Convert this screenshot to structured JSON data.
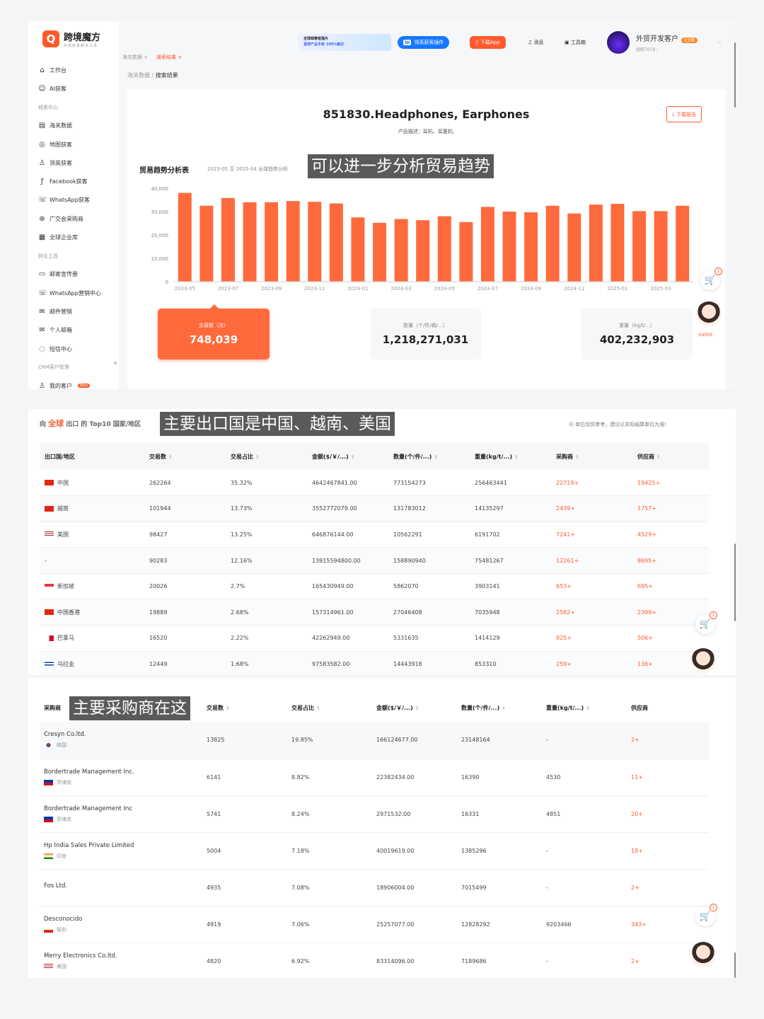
{
  "app": {
    "logo_char": "Q",
    "title": "跨境魔方",
    "subtitle": "外贸获客服务工具"
  },
  "sidebar": {
    "items": [
      {
        "label": "工作台",
        "icon": "home-icon",
        "glyph": "⌂"
      },
      {
        "label": "AI获客",
        "icon": "robot-icon",
        "glyph": "☺"
      },
      {
        "section": "线索中心"
      },
      {
        "label": "海关数据",
        "icon": "customs-icon",
        "glyph": "▤"
      },
      {
        "label": "地图获客",
        "icon": "map-icon",
        "glyph": "◎"
      },
      {
        "label": "领英获客",
        "icon": "person-icon",
        "glyph": "♙"
      },
      {
        "label": "Facebook获客",
        "icon": "facebook-icon",
        "glyph": "ƒ"
      },
      {
        "label": "WhatsApp获客",
        "icon": "whatsapp-icon",
        "glyph": "☏"
      },
      {
        "label": "广交会采购商",
        "icon": "globe-icon",
        "glyph": "⊕"
      },
      {
        "label": "全球企业库",
        "icon": "building-icon",
        "glyph": "▦"
      },
      {
        "section": "转化工具"
      },
      {
        "label": "邮寄宣传册",
        "icon": "brochure-icon",
        "glyph": "▭"
      },
      {
        "label": "WhatsApp营销中心",
        "icon": "whatsapp-icon",
        "glyph": "☏"
      },
      {
        "label": "邮件营销",
        "icon": "mail-icon",
        "glyph": "✉"
      },
      {
        "label": "个人邮箱",
        "icon": "mailbox-icon",
        "glyph": "✉"
      },
      {
        "label": "短信中心",
        "icon": "sms-icon",
        "glyph": "◌"
      },
      {
        "section": "CRM客户管理"
      },
      {
        "label": "我的客户",
        "icon": "customer-icon",
        "glyph": "♙",
        "badge": "New"
      }
    ],
    "collapse": "«"
  },
  "header": {
    "tabs": [
      "海关数据 ×",
      "搜索结果 ×"
    ],
    "promo_line1": "全球邮寄纸值片",
    "promo_line2": "直邮产品手册 100%触达",
    "linkedin_plugin": "领英获客插件",
    "download_app": "下载App",
    "messages": "消息",
    "toolbox": "工具箱",
    "user_name": "外贸开发客户",
    "user_badge": "企业版",
    "user_org": "组织7078 ›"
  },
  "breadcrumb": {
    "parent": "海关数据 / ",
    "current": "搜索结果"
  },
  "product": {
    "title": "851830.Headphones, Earphones",
    "description": "产品描述：耳机、耳塞机;",
    "download_report": "下载报告"
  },
  "trend": {
    "title": "贸易趋势分析表",
    "subtitle": "2023-05 至 2025-04 全球趋势分析"
  },
  "overlays": {
    "o1": "可以进一步分析贸易趋势",
    "o2": "主要出口国是中国、越南、美国",
    "o3": "主要采购商在这"
  },
  "stats": [
    {
      "label": "交易数（次）",
      "value": "748,039"
    },
    {
      "label": "数量（个/件/箱/...）",
      "value": "1,218,271,031"
    },
    {
      "label": "重量（kg/t/...）",
      "value": "402,232,903"
    }
  ],
  "floating": {
    "cart_count": "1",
    "agent_label": "外贸导师"
  },
  "chart_data": {
    "type": "bar",
    "x": [
      "2023-05",
      "2023-06",
      "2023-07",
      "2023-08",
      "2023-09",
      "2023-10",
      "2023-11",
      "2023-12",
      "2024-01",
      "2024-02",
      "2024-03",
      "2024-04",
      "2024-05",
      "2024-06",
      "2024-07",
      "2024-08",
      "2024-09",
      "2024-10",
      "2024-11",
      "2024-12",
      "2025-01",
      "2025-02",
      "2025-03",
      "2025-04"
    ],
    "tick_labels": [
      "2023-05",
      "2023-07",
      "2023-09",
      "2023-11",
      "2024-01",
      "2024-03",
      "2024-05",
      "2024-07",
      "2024-09",
      "2024-11",
      "2025-01",
      "2025-03"
    ],
    "values": [
      38000,
      32500,
      35800,
      34000,
      34000,
      34500,
      34200,
      33500,
      27500,
      25200,
      26800,
      26300,
      28000,
      25500,
      32000,
      30000,
      29700,
      32500,
      29200,
      33000,
      33300,
      30200,
      30200,
      32500
    ],
    "ylim": [
      0,
      40000
    ],
    "yticks": [
      "0",
      "10,000",
      "20,000",
      "30,000",
      "40,000"
    ],
    "color": "#ff6a3c",
    "grid": true
  },
  "countries": {
    "head_prefix": "向 ",
    "head_hl": "全球",
    "head_suffix": " 出口 的 Top10 国家/地区",
    "note": "⓪ 单位仅供参考，建议以实际结算单位为准!",
    "columns": [
      "出口国/地区",
      "交易数",
      "交易占比",
      "金额($/￥/...)",
      "数量(个/件/...)",
      "重量(kg/t/...)",
      "采购商",
      "供应商"
    ],
    "rows": [
      {
        "country": "中国",
        "flag": "cn",
        "trades": "262264",
        "share": "35.32%",
        "amount": "4642467841.00",
        "qty": "773154273",
        "weight": "256463441",
        "buyers": "22719+",
        "suppliers": "19425+"
      },
      {
        "country": "越南",
        "flag": "vn",
        "trades": "101944",
        "share": "13.73%",
        "amount": "3552772079.00",
        "qty": "131783012",
        "weight": "14135297",
        "buyers": "2439+",
        "suppliers": "1757+"
      },
      {
        "country": "美国",
        "flag": "us",
        "trades": "98427",
        "share": "13.25%",
        "amount": "646876144.00",
        "qty": "10562291",
        "weight": "6191702",
        "buyers": "7241+",
        "suppliers": "4529+"
      },
      {
        "country": "-",
        "flag": "",
        "trades": "90283",
        "share": "12.16%",
        "amount": "13915594800.00",
        "qty": "158890940",
        "weight": "75481267",
        "buyers": "12261+",
        "suppliers": "8695+"
      },
      {
        "country": "新加坡",
        "flag": "sg",
        "trades": "20026",
        "share": "2.7%",
        "amount": "165430949.00",
        "qty": "5862070",
        "weight": "3903141",
        "buyers": "653+",
        "suppliers": "695+"
      },
      {
        "country": "中国香港",
        "flag": "hk",
        "trades": "19889",
        "share": "2.68%",
        "amount": "157314961.00",
        "qty": "27046408",
        "weight": "7035948",
        "buyers": "2582+",
        "suppliers": "2399+"
      },
      {
        "country": "巴拿马",
        "flag": "pa",
        "trades": "16520",
        "share": "2.22%",
        "amount": "42262949.00",
        "qty": "5331635",
        "weight": "1414129",
        "buyers": "825+",
        "suppliers": "506+"
      },
      {
        "country": "乌拉圭",
        "flag": "uy",
        "trades": "12449",
        "share": "1.68%",
        "amount": "97583582.00",
        "qty": "14443918",
        "weight": "853310",
        "buyers": "259+",
        "suppliers": "136+"
      }
    ]
  },
  "buyers": {
    "columns": [
      "采购商",
      "交易数",
      "交易占比",
      "金额($/￥/...)",
      "数量(个/件/...)",
      "重量(kg/t/...)",
      "供应商"
    ],
    "rows": [
      {
        "name": "Cresyn Co.ltd.",
        "country": "韩国",
        "flag": "kr",
        "trades": "13825",
        "share": "19.85%",
        "amount": "166124677.00",
        "qty": "23148164",
        "weight": "-",
        "suppliers": "2+"
      },
      {
        "name": "Bordertrade Management Inc.",
        "country": "菲律宾",
        "flag": "ph",
        "trades": "6141",
        "share": "8.82%",
        "amount": "22382434.00",
        "qty": "16390",
        "weight": "4530",
        "suppliers": "11+"
      },
      {
        "name": "Bordertrade Management Inc",
        "country": "菲律宾",
        "flag": "ph",
        "trades": "5741",
        "share": "8.24%",
        "amount": "2971532.00",
        "qty": "16331",
        "weight": "4851",
        "suppliers": "20+"
      },
      {
        "name": "Hp India Sales Private Limited",
        "country": "印度",
        "flag": "in",
        "trades": "5004",
        "share": "7.18%",
        "amount": "40019619.00",
        "qty": "1385296",
        "weight": "-",
        "suppliers": "18+"
      },
      {
        "name": "Fos Ltd.",
        "country": "",
        "flag": "",
        "trades": "4935",
        "share": "7.08%",
        "amount": "18906004.00",
        "qty": "7015499",
        "weight": "-",
        "suppliers": "2+"
      },
      {
        "name": "Desconocido",
        "country": "智利",
        "flag": "cl",
        "trades": "4919",
        "share": "7.06%",
        "amount": "25257077.00",
        "qty": "12828292",
        "weight": "9203466",
        "suppliers": "343+"
      },
      {
        "name": "Merry Electronics Co.ltd.",
        "country": "美国",
        "flag": "us",
        "trades": "4820",
        "share": "6.92%",
        "amount": "83314096.00",
        "qty": "7189686",
        "weight": "-",
        "suppliers": "2+"
      }
    ]
  }
}
